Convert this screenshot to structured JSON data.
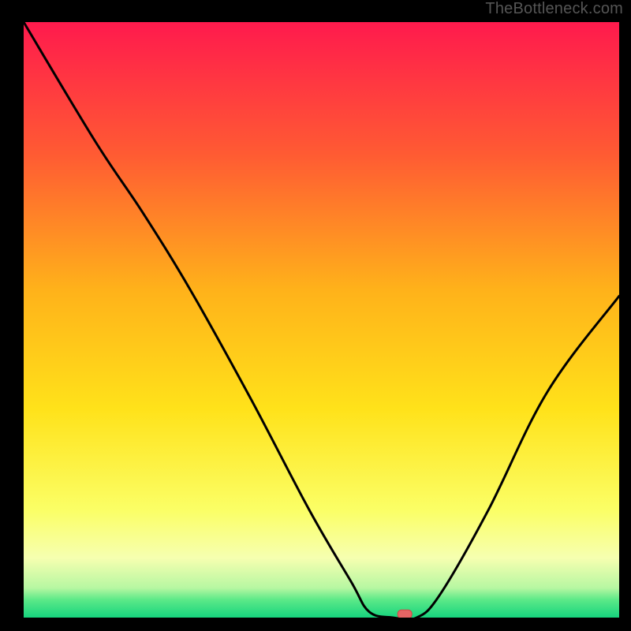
{
  "watermark": "TheBottleneck.com",
  "colors": {
    "frame_bg": "#000000",
    "gradient_top": "#ff1a4d",
    "gradient_mid1": "#ff7a2a",
    "gradient_mid2": "#ffd21a",
    "gradient_low": "#fbffad",
    "gradient_green": "#17e07a",
    "gradient_bottom": "#16d47e",
    "curve_stroke": "#000000",
    "marker_fill": "#e46464",
    "marker_stroke": "#d24646"
  },
  "chart_data": {
    "type": "line",
    "title": "",
    "xlabel": "",
    "ylabel": "",
    "xlim": [
      0,
      100
    ],
    "ylim": [
      0,
      100
    ],
    "curve": [
      {
        "x": 0,
        "y": 100
      },
      {
        "x": 12,
        "y": 80
      },
      {
        "x": 20,
        "y": 68
      },
      {
        "x": 28,
        "y": 55
      },
      {
        "x": 38,
        "y": 37
      },
      {
        "x": 48,
        "y": 18
      },
      {
        "x": 55,
        "y": 6
      },
      {
        "x": 58,
        "y": 1
      },
      {
        "x": 62,
        "y": 0
      },
      {
        "x": 66,
        "y": 0
      },
      {
        "x": 70,
        "y": 4
      },
      {
        "x": 78,
        "y": 18
      },
      {
        "x": 88,
        "y": 38
      },
      {
        "x": 100,
        "y": 54
      }
    ],
    "marker": {
      "x": 64,
      "y": 0.5
    }
  }
}
